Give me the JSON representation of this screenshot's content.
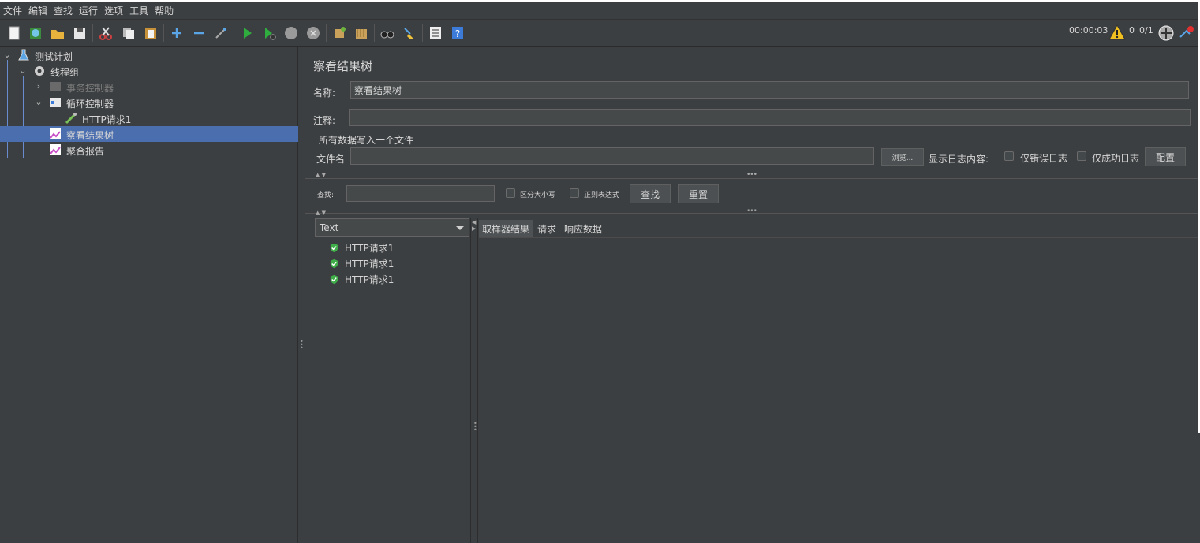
{
  "menu": [
    "文件",
    "编辑",
    "查找",
    "运行",
    "选项",
    "工具",
    "帮助"
  ],
  "toolbar": {
    "timer": "00:00:03",
    "warning_count": "0",
    "threads": "0/1"
  },
  "tree": {
    "test_plan": "测试计划",
    "thread_group": "线程组",
    "transaction_controller": "事务控制器",
    "loop_controller": "循环控制器",
    "http_request": "HTTP请求1",
    "view_results_tree": "察看结果树",
    "aggregate_report": "聚合报告"
  },
  "panel": {
    "title": "察看结果树",
    "name_label": "名称:",
    "name_value": "察看结果树",
    "comment_label": "注释:",
    "comment_value": "",
    "file_group_title": "所有数据写入一个文件",
    "filename_label": "文件名",
    "filename_value": "",
    "browse_button": "浏览...",
    "log_content_label": "显示日志内容:",
    "errors_only": "仅错误日志",
    "success_only": "仅成功日志",
    "config_button": "配置",
    "search_label": "查找:",
    "search_value": "",
    "case_sensitive": "区分大小写",
    "regex": "正则表达式",
    "find_button": "查找",
    "reset_button": "重置"
  },
  "results": {
    "renderer": "Text",
    "items": [
      "HTTP请求1",
      "HTTP请求1",
      "HTTP请求1"
    ],
    "tabs": [
      "取样器结果",
      "请求",
      "响应数据"
    ],
    "active_tab": 0
  },
  "colors": {
    "background": "#3c3f41",
    "selection": "#4b6eaf",
    "success_icon": "#3fae49"
  }
}
